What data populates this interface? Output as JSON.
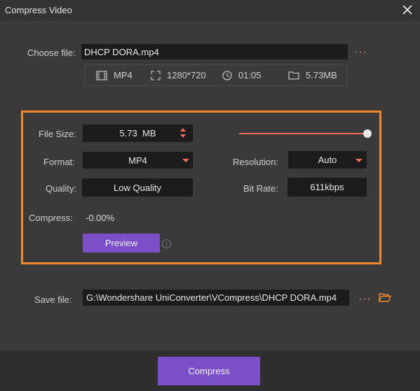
{
  "window": {
    "title": "Compress Video"
  },
  "choose_file": {
    "label": "Choose file:",
    "value": "DHCP DORA.mp4",
    "more": "···"
  },
  "file_info": {
    "format": "MP4",
    "resolution": "1280*720",
    "duration": "01:05",
    "size": "5.73MB"
  },
  "settings": {
    "file_size_label": "File Size:",
    "file_size_value": "5.73  MB",
    "file_size_slider_fraction": 1.0,
    "format_label": "Format:",
    "format_value": "MP4",
    "resolution_label": "Resolution:",
    "resolution_value": "Auto",
    "quality_label": "Quality:",
    "quality_value": "Low Quality",
    "bitrate_label": "Bit Rate:",
    "bitrate_value": "611kbps",
    "compress_label": "Compress:",
    "compress_value": "-0.00%",
    "preview_label": "Preview",
    "info_glyph": "i"
  },
  "save_file": {
    "label": "Save file:",
    "value": "G:\\Wondershare UniConverter\\VCompress\\DHCP DORA.mp4",
    "more": "···"
  },
  "footer": {
    "compress_label": "Compress"
  },
  "colors": {
    "accent_orange": "#f0892c",
    "accent_coral": "#f06b5a",
    "button_purple": "#7b4fc8",
    "background": "#3a3a3b",
    "field_bg": "#1c1c1d"
  },
  "icons": [
    "close-icon",
    "film-icon",
    "resize-icon",
    "clock-icon",
    "folder-icon",
    "up-down-arrows-icon",
    "dropdown-caret-icon",
    "info-icon",
    "open-folder-icon",
    "more-dots-icon"
  ]
}
